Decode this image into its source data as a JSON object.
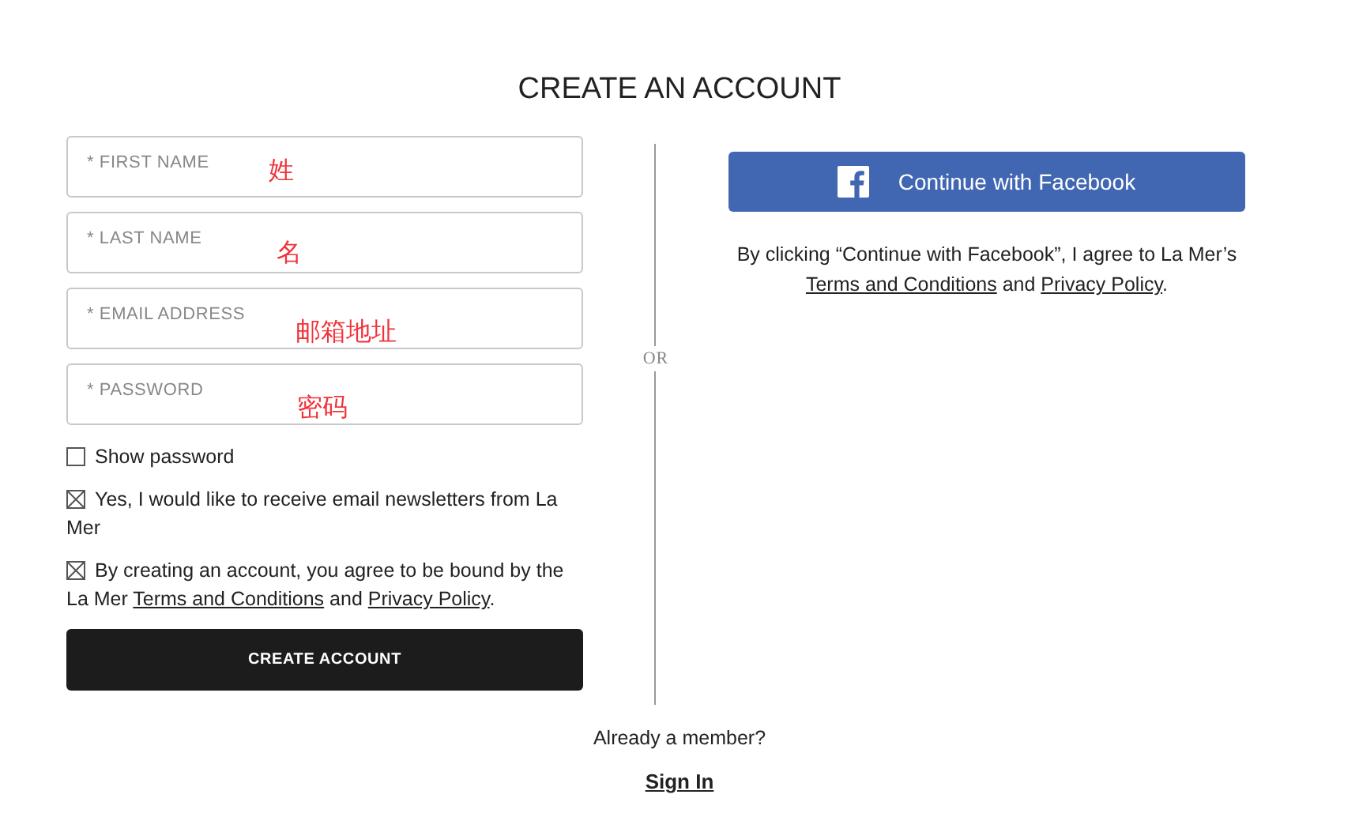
{
  "title": "CREATE AN ACCOUNT",
  "fields": [
    {
      "placeholder": "* FIRST NAME",
      "annotation": "姓"
    },
    {
      "placeholder": "* LAST NAME",
      "annotation": "名"
    },
    {
      "placeholder": "* EMAIL ADDRESS",
      "annotation": "邮箱地址"
    },
    {
      "placeholder": "* PASSWORD",
      "annotation": "密码"
    }
  ],
  "checkboxes": [
    {
      "checked": false,
      "segments": [
        {
          "kind": "text",
          "text": "Show password"
        }
      ]
    },
    {
      "checked": true,
      "segments": [
        {
          "kind": "text",
          "text": "Yes, I would like to receive email newsletters from La Mer"
        }
      ]
    },
    {
      "checked": true,
      "segments": [
        {
          "kind": "text",
          "text": "By creating an account, you agree to be bound by the La Mer "
        },
        {
          "kind": "link",
          "text": "Terms and Conditions"
        },
        {
          "kind": "text",
          "text": " and "
        },
        {
          "kind": "link",
          "text": "Privacy Policy"
        },
        {
          "kind": "text",
          "text": "."
        }
      ]
    }
  ],
  "create_button": "CREATE ACCOUNT",
  "divider_label": "OR",
  "facebook_button": "Continue with Facebook",
  "facebook_note": [
    {
      "kind": "text",
      "text": "By clicking “Continue with Facebook”, I agree to La Mer’s "
    },
    {
      "kind": "link",
      "text": "Terms and Conditions"
    },
    {
      "kind": "text",
      "text": " and "
    },
    {
      "kind": "link",
      "text": "Privacy Policy"
    },
    {
      "kind": "text",
      "text": "."
    }
  ],
  "member_prompt": "Already a member?",
  "sign_in": "Sign In"
}
